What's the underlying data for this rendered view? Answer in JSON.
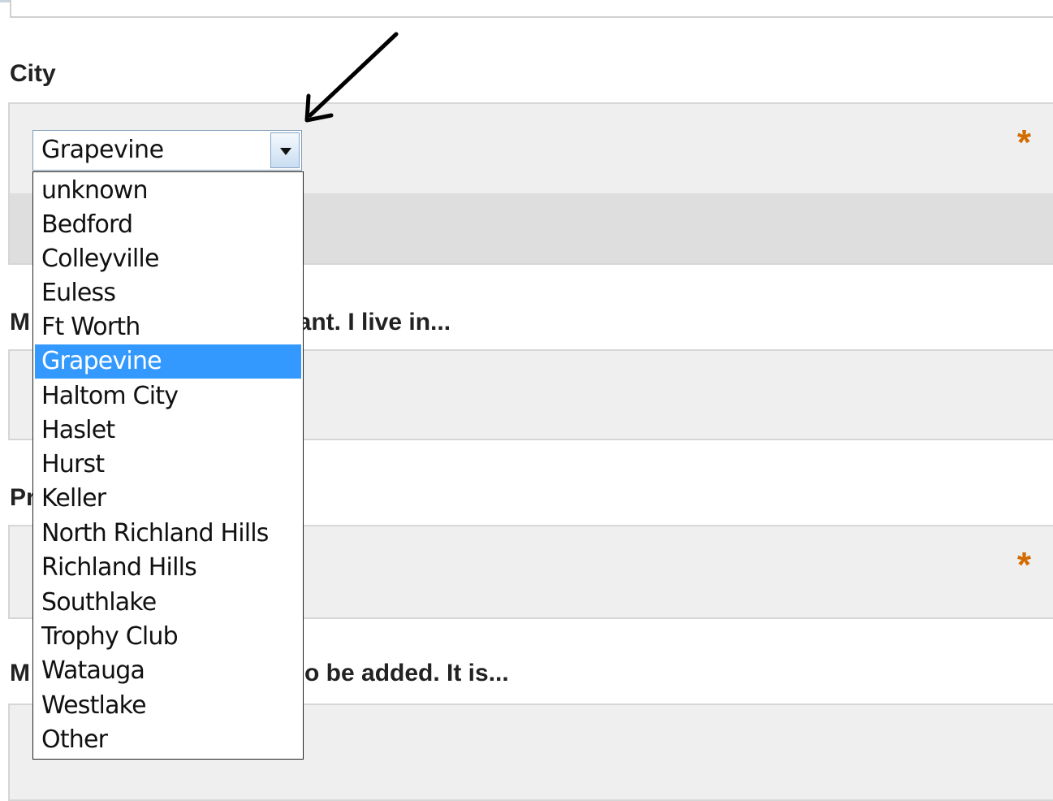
{
  "city": {
    "label": "City",
    "required_marker": "*",
    "selected_value": "Grapevine",
    "options": [
      "unknown",
      "Bedford",
      "Colleyville",
      "Euless",
      "Ft Worth",
      "Grapevine",
      "Haltom City",
      "Haslet",
      "Hurst",
      "Keller",
      "North Richland Hills",
      "Richland Hills",
      "Southlake",
      "Trophy Club",
      "Watauga",
      "Westlake",
      "Other"
    ],
    "highlighted_option": "Grapevine"
  },
  "section2": {
    "label_start": "M",
    "label_end": "rant. I live in..."
  },
  "section3": {
    "label_start": "Pr",
    "required_marker": "*"
  },
  "section4": {
    "label_start": "M",
    "label_end": "o be added. It is..."
  },
  "colors": {
    "accent_selected": "#3399ff",
    "required": "#d26b00",
    "panel_bg": "#efefef"
  },
  "icons": {
    "annotation_arrow": "arrow-icon",
    "dropdown_toggle": "chevron-down-icon"
  }
}
